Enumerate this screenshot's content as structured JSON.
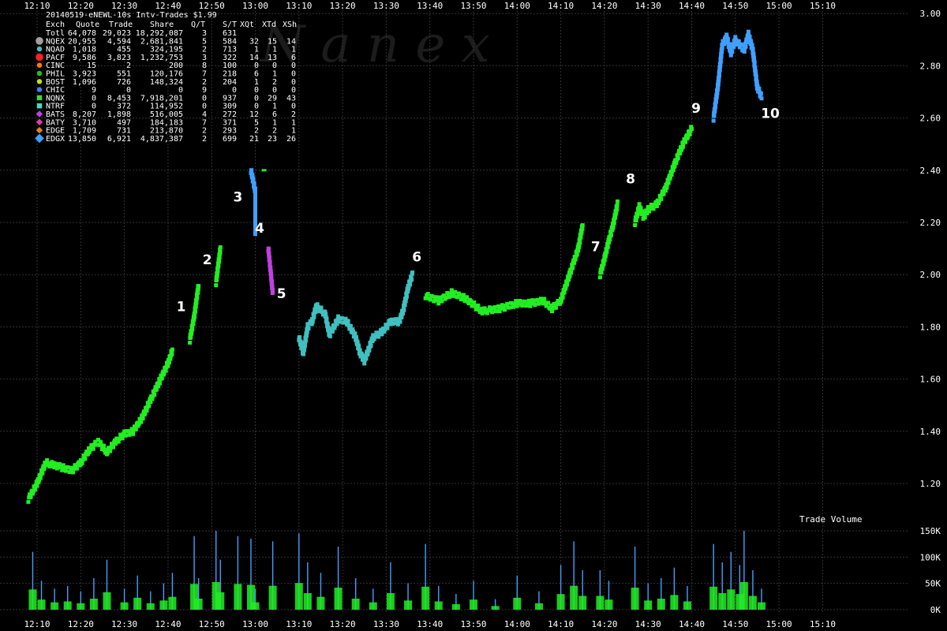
{
  "header": {
    "title": "20140519-eNEWL-10s Intv-Trades $1.99",
    "columns": [
      "Exch",
      "Quote",
      "Trade",
      "Share",
      "Q/T",
      "S/T",
      "XQt",
      "XTd",
      "XSh"
    ],
    "rows": [
      {
        "exch": "Totl",
        "quote": "64,078",
        "trade": "29,023",
        "share": "18,292,087",
        "qt": "3",
        "st": "631",
        "xqt": "",
        "xtd": "",
        "xsh": "",
        "color": "",
        "marker": "none"
      },
      {
        "exch": "NQEX",
        "quote": "20,955",
        "trade": "4,594",
        "share": "2,681,841",
        "qt": "5",
        "st": "584",
        "xqt": "32",
        "xtd": "15",
        "xsh": "14",
        "color": "#a0a0a0",
        "marker": "circle-lg"
      },
      {
        "exch": "NQAD",
        "quote": "1,018",
        "trade": "455",
        "share": "324,195",
        "qt": "2",
        "st": "713",
        "xqt": "1",
        "xtd": "1",
        "xsh": "1",
        "color": "#40c0c0",
        "marker": "circle"
      },
      {
        "exch": "PACF",
        "quote": "9,586",
        "trade": "3,823",
        "share": "1,232,753",
        "qt": "3",
        "st": "322",
        "xqt": "14",
        "xtd": "13",
        "xsh": "6",
        "color": "#ff2020",
        "marker": "circle-lg"
      },
      {
        "exch": "CINC",
        "quote": "15",
        "trade": "2",
        "share": "200",
        "qt": "8",
        "st": "100",
        "xqt": "0",
        "xtd": "0",
        "xsh": "0",
        "color": "#ff8000",
        "marker": "circle"
      },
      {
        "exch": "PHIL",
        "quote": "3,923",
        "trade": "551",
        "share": "120,176",
        "qt": "7",
        "st": "218",
        "xqt": "6",
        "xtd": "1",
        "xsh": "0",
        "color": "#20c020",
        "marker": "circle"
      },
      {
        "exch": "BOST",
        "quote": "1,096",
        "trade": "726",
        "share": "148,324",
        "qt": "2",
        "st": "204",
        "xqt": "1",
        "xtd": "2",
        "xsh": "0",
        "color": "#c0e020",
        "marker": "circle"
      },
      {
        "exch": "CHIC",
        "quote": "9",
        "trade": "0",
        "share": "0",
        "qt": "9",
        "st": "0",
        "xqt": "0",
        "xtd": "0",
        "xsh": "0",
        "color": "#4080ff",
        "marker": "circle"
      },
      {
        "exch": "NQNX",
        "quote": "0",
        "trade": "8,453",
        "share": "7,918,201",
        "qt": "0",
        "st": "937",
        "xqt": "0",
        "xtd": "29",
        "xsh": "43",
        "color": "#30e030",
        "marker": "square"
      },
      {
        "exch": "NTRF",
        "quote": "0",
        "trade": "372",
        "share": "114,952",
        "qt": "0",
        "st": "309",
        "xqt": "0",
        "xtd": "1",
        "xsh": "0",
        "color": "#40e0c0",
        "marker": "square"
      },
      {
        "exch": "BATS",
        "quote": "8,207",
        "trade": "1,898",
        "share": "516,005",
        "qt": "4",
        "st": "272",
        "xqt": "12",
        "xtd": "6",
        "xsh": "2",
        "color": "#c040e0",
        "marker": "diamond"
      },
      {
        "exch": "BATY",
        "quote": "3,710",
        "trade": "497",
        "share": "184,183",
        "qt": "7",
        "st": "371",
        "xqt": "5",
        "xtd": "1",
        "xsh": "1",
        "color": "#e040a0",
        "marker": "diamond"
      },
      {
        "exch": "EDGE",
        "quote": "1,709",
        "trade": "731",
        "share": "213,870",
        "qt": "2",
        "st": "293",
        "xqt": "2",
        "xtd": "2",
        "xsh": "1",
        "color": "#e08020",
        "marker": "diamond"
      },
      {
        "exch": "EDGX",
        "quote": "13,850",
        "trade": "6,921",
        "share": "4,837,387",
        "qt": "2",
        "st": "699",
        "xqt": "21",
        "xtd": "23",
        "xsh": "26",
        "color": "#40a0ff",
        "marker": "diamond-lg"
      }
    ]
  },
  "watermark": "N a n e x",
  "colors": {
    "background": "#000000",
    "text": "#ffffff",
    "grid": "#333333",
    "trade": "#22ee22",
    "volume_base": "#a0a0a0"
  },
  "chart_data": [
    {
      "type": "scatter",
      "title": "20140519-eNEWL-10s Intv-Trades $1.99",
      "x_ticks": [
        "12:10",
        "12:20",
        "12:30",
        "12:40",
        "12:50",
        "13:00",
        "13:10",
        "13:20",
        "13:30",
        "13:40",
        "13:50",
        "14:00",
        "14:10",
        "14:20",
        "14:30",
        "14:40",
        "14:50",
        "15:00",
        "15:10"
      ],
      "y_ticks": [
        "1.20",
        "1.40",
        "1.60",
        "1.80",
        "2.00",
        "2.20",
        "2.40",
        "2.60",
        "2.80",
        "3.00"
      ],
      "ylim": [
        1.1,
        3.0
      ],
      "xlim": [
        "12:08",
        "15:15"
      ],
      "grid": true,
      "series": [
        {
          "x": [
            "12:08",
            "12:10",
            "12:12",
            "12:14",
            "12:16",
            "12:18",
            "12:20",
            "12:22",
            "12:24",
            "12:26",
            "12:28",
            "12:30",
            "12:32",
            "12:34",
            "12:36",
            "12:38",
            "12:40",
            "12:41"
          ],
          "y": [
            1.14,
            1.2,
            1.28,
            1.27,
            1.26,
            1.25,
            1.28,
            1.33,
            1.36,
            1.32,
            1.36,
            1.39,
            1.4,
            1.45,
            1.52,
            1.59,
            1.66,
            1.71
          ]
        },
        {
          "x": [
            "12:45",
            "12:46",
            "12:47"
          ],
          "y": [
            1.75,
            1.84,
            1.96
          ]
        },
        {
          "x": [
            "12:51",
            "12:52"
          ],
          "y": [
            1.97,
            2.1
          ]
        },
        {
          "x": [
            "12:59",
            "13:00",
            "13:00"
          ],
          "y": [
            2.4,
            2.32,
            2.16
          ]
        },
        {
          "x": [
            "13:02"
          ],
          "y": [
            2.4
          ]
        },
        {
          "x": [
            "13:03",
            "13:04"
          ],
          "y": [
            2.1,
            1.93
          ]
        },
        {
          "x": [
            "13:10",
            "13:11",
            "13:12",
            "13:13",
            "13:14",
            "13:16",
            "13:17",
            "13:19",
            "13:21",
            "13:23",
            "13:24",
            "13:25",
            "13:27",
            "13:29",
            "13:31",
            "13:33",
            "13:34",
            "13:35",
            "13:36"
          ],
          "y": [
            1.76,
            1.7,
            1.8,
            1.82,
            1.88,
            1.85,
            1.77,
            1.83,
            1.82,
            1.76,
            1.7,
            1.67,
            1.76,
            1.78,
            1.82,
            1.82,
            1.87,
            1.95,
            2.0
          ]
        },
        {
          "x": [
            "13:39",
            "13:42",
            "13:45",
            "13:48",
            "13:52",
            "13:56",
            "14:00",
            "14:03",
            "14:06",
            "14:08",
            "14:10",
            "14:12",
            "14:14",
            "14:15"
          ],
          "y": [
            1.92,
            1.9,
            1.93,
            1.91,
            1.86,
            1.87,
            1.89,
            1.89,
            1.9,
            1.87,
            1.9,
            2.0,
            2.1,
            2.19
          ]
        },
        {
          "x": [
            "14:19",
            "14:20",
            "14:21",
            "14:22",
            "14:23"
          ],
          "y": [
            2.0,
            2.06,
            2.13,
            2.19,
            2.27
          ]
        },
        {
          "x": [
            "14:27",
            "14:28",
            "14:29",
            "14:30",
            "14:32",
            "14:34",
            "14:36",
            "14:38",
            "14:40"
          ],
          "y": [
            2.2,
            2.26,
            2.22,
            2.25,
            2.27,
            2.33,
            2.42,
            2.5,
            2.56
          ]
        },
        {
          "x": [
            "14:45",
            "14:46",
            "14:47",
            "14:48",
            "14:49",
            "14:50",
            "14:51",
            "14:52",
            "14:53",
            "14:54",
            "14:55",
            "14:56"
          ],
          "y": [
            2.6,
            2.72,
            2.88,
            2.91,
            2.85,
            2.9,
            2.88,
            2.86,
            2.92,
            2.86,
            2.72,
            2.68
          ]
        }
      ],
      "annotations": [
        {
          "label": "1",
          "x": "12:43",
          "y": 1.86
        },
        {
          "label": "2",
          "x": "12:49",
          "y": 2.04
        },
        {
          "label": "3",
          "x": "12:56",
          "y": 2.28
        },
        {
          "label": "4",
          "x": "13:01",
          "y": 2.16
        },
        {
          "label": "5",
          "x": "13:06",
          "y": 1.91
        },
        {
          "label": "6",
          "x": "13:37",
          "y": 2.05
        },
        {
          "label": "7",
          "x": "14:18",
          "y": 2.09
        },
        {
          "label": "8",
          "x": "14:26",
          "y": 2.35
        },
        {
          "label": "9",
          "x": "14:41",
          "y": 2.62
        },
        {
          "label": "10",
          "x": "14:58",
          "y": 2.6
        }
      ]
    },
    {
      "type": "bar",
      "title": "Trade Volume",
      "y_ticks": [
        "0K",
        "50K",
        "100K",
        "150K"
      ],
      "ylim": [
        0,
        150000
      ],
      "grid": true,
      "x": [
        "12:09",
        "12:11",
        "12:14",
        "12:17",
        "12:20",
        "12:23",
        "12:26",
        "12:30",
        "12:33",
        "12:36",
        "12:39",
        "12:41",
        "12:46",
        "12:47",
        "12:51",
        "12:52",
        "12:56",
        "12:59",
        "13:00",
        "13:04",
        "13:10",
        "13:12",
        "13:15",
        "13:19",
        "13:23",
        "13:27",
        "13:31",
        "13:35",
        "13:39",
        "13:42",
        "13:46",
        "13:50",
        "13:55",
        "14:00",
        "14:05",
        "14:10",
        "14:13",
        "14:15",
        "14:19",
        "14:21",
        "14:27",
        "14:30",
        "14:33",
        "14:36",
        "14:39",
        "14:45",
        "14:47",
        "14:49",
        "14:51",
        "14:52",
        "14:54",
        "14:56"
      ],
      "values": [
        110000,
        55000,
        40000,
        45000,
        35000,
        60000,
        95000,
        40000,
        65000,
        35000,
        50000,
        70000,
        140000,
        60000,
        150000,
        95000,
        140000,
        135000,
        40000,
        130000,
        145000,
        90000,
        70000,
        120000,
        60000,
        40000,
        90000,
        50000,
        125000,
        45000,
        30000,
        55000,
        20000,
        65000,
        35000,
        85000,
        130000,
        75000,
        75000,
        55000,
        120000,
        50000,
        60000,
        80000,
        45000,
        125000,
        90000,
        110000,
        85000,
        150000,
        75000,
        40000
      ]
    }
  ]
}
